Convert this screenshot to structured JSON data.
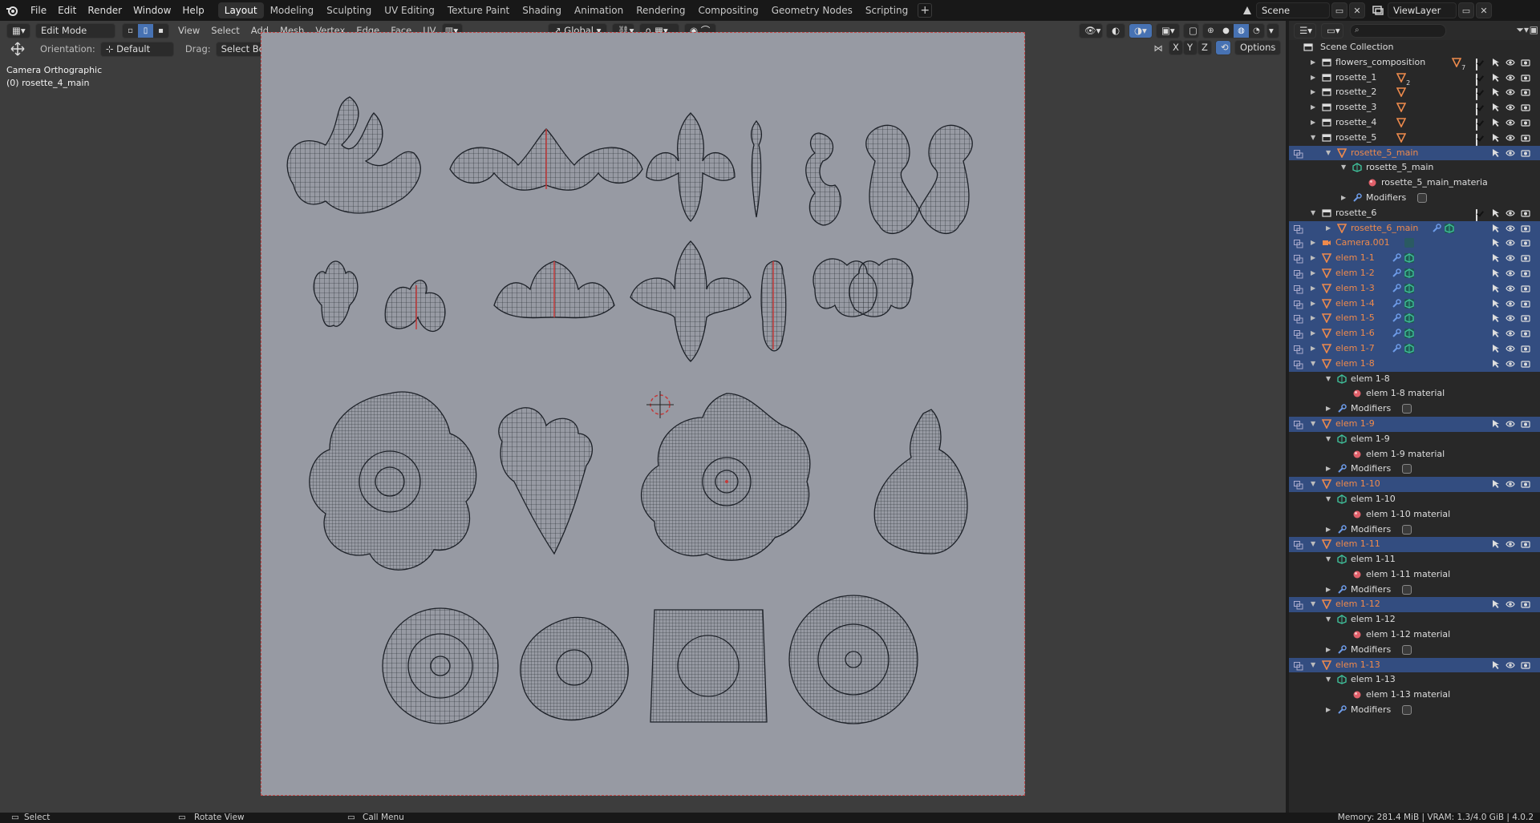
{
  "topbar": {
    "menus": [
      "File",
      "Edit",
      "Render",
      "Window",
      "Help"
    ],
    "workspaces": [
      "Layout",
      "Modeling",
      "Sculpting",
      "UV Editing",
      "Texture Paint",
      "Shading",
      "Animation",
      "Rendering",
      "Compositing",
      "Geometry Nodes",
      "Scripting"
    ],
    "active_workspace": "Layout",
    "add_workspace": "+",
    "scene": "Scene",
    "view_layer": "ViewLayer"
  },
  "viewport_header": {
    "mode": "Edit Mode",
    "menus": [
      "View",
      "Select",
      "Add",
      "Mesh",
      "Vertex",
      "Edge",
      "Face",
      "UV"
    ],
    "transform_orientation": "Global",
    "orientation_label": "Orientation:",
    "orientation_value": "Default",
    "drag_label": "Drag:",
    "drag_value": "Select Box",
    "axes": [
      "X",
      "Y",
      "Z"
    ],
    "options": "Options"
  },
  "viewport_info": {
    "view_name": "Camera Orthographic",
    "active_object": "(0) rosette_4_main"
  },
  "outliner": {
    "root": "Scene Collection",
    "rows": [
      {
        "label": "flowers_composition",
        "depth": 1,
        "arrow": "right",
        "type": "collection",
        "badge": "7",
        "checkbox": true,
        "selectable": true
      },
      {
        "label": "rosette_1",
        "depth": 1,
        "arrow": "right",
        "type": "collection",
        "badge": "2",
        "checkbox": true,
        "selectable": true
      },
      {
        "label": "rosette_2",
        "depth": 1,
        "arrow": "right",
        "type": "collection",
        "badge": "",
        "checkbox": true,
        "selectable": true
      },
      {
        "label": "rosette_3",
        "depth": 1,
        "arrow": "right",
        "type": "collection",
        "badge": "",
        "checkbox": true,
        "selectable": true
      },
      {
        "label": "rosette_4",
        "depth": 1,
        "arrow": "right",
        "type": "collection",
        "badge": "",
        "checkbox": true,
        "selectable": true
      },
      {
        "label": "rosette_5",
        "depth": 1,
        "arrow": "down",
        "type": "collection",
        "badge": "",
        "checkbox": true,
        "selectable": true
      },
      {
        "label": "rosette_5_main",
        "depth": 2,
        "arrow": "down",
        "type": "object",
        "orange": true,
        "selected": true,
        "selectable": true
      },
      {
        "label": "rosette_5_main",
        "depth": 3,
        "arrow": "down",
        "type": "mesh"
      },
      {
        "label": "rosette_5_main_materia",
        "depth": 4,
        "arrow": "",
        "type": "material"
      },
      {
        "label": "Modifiers",
        "depth": 3,
        "arrow": "right",
        "type": "modifier",
        "modbadge": true
      },
      {
        "label": "rosette_6",
        "depth": 1,
        "arrow": "down",
        "type": "collection",
        "checkbox": true,
        "selectable": true
      },
      {
        "label": "rosette_6_main",
        "depth": 2,
        "arrow": "right",
        "type": "object",
        "orange": true,
        "selected": true,
        "wrench": true,
        "selectable": true
      },
      {
        "label": "Camera.001",
        "depth": 1,
        "arrow": "right",
        "type": "camera",
        "orange": true,
        "selected": true,
        "selectable": true
      },
      {
        "label": "elem 1-1",
        "depth": 1,
        "arrow": "right",
        "type": "object",
        "orange": true,
        "selected": true,
        "wrench": true,
        "selectable": true
      },
      {
        "label": "elem 1-2",
        "depth": 1,
        "arrow": "right",
        "type": "object",
        "orange": true,
        "selected": true,
        "wrench": true,
        "selectable": true
      },
      {
        "label": "elem 1-3",
        "depth": 1,
        "arrow": "right",
        "type": "object",
        "orange": true,
        "selected": true,
        "wrench": true,
        "selectable": true
      },
      {
        "label": "elem 1-4",
        "depth": 1,
        "arrow": "right",
        "type": "object",
        "orange": true,
        "selected": true,
        "wrench": true,
        "selectable": true
      },
      {
        "label": "elem 1-5",
        "depth": 1,
        "arrow": "right",
        "type": "object",
        "orange": true,
        "selected": true,
        "wrench": true,
        "selectable": true
      },
      {
        "label": "elem 1-6",
        "depth": 1,
        "arrow": "right",
        "type": "object",
        "orange": true,
        "selected": true,
        "wrench": true,
        "selectable": true
      },
      {
        "label": "elem 1-7",
        "depth": 1,
        "arrow": "right",
        "type": "object",
        "orange": true,
        "selected": true,
        "wrench": true,
        "selectable": true
      },
      {
        "label": "elem 1-8",
        "depth": 1,
        "arrow": "down",
        "type": "object",
        "orange": true,
        "selected": true,
        "selectable": true
      },
      {
        "label": "elem 1-8",
        "depth": 2,
        "arrow": "down",
        "type": "mesh"
      },
      {
        "label": "elem 1-8 material",
        "depth": 3,
        "arrow": "",
        "type": "material"
      },
      {
        "label": "Modifiers",
        "depth": 2,
        "arrow": "right",
        "type": "modifier",
        "modbadge": true
      },
      {
        "label": "elem 1-9",
        "depth": 1,
        "arrow": "down",
        "type": "object",
        "orange": true,
        "selected": true,
        "selectable": true
      },
      {
        "label": "elem 1-9",
        "depth": 2,
        "arrow": "down",
        "type": "mesh"
      },
      {
        "label": "elem 1-9 material",
        "depth": 3,
        "arrow": "",
        "type": "material"
      },
      {
        "label": "Modifiers",
        "depth": 2,
        "arrow": "right",
        "type": "modifier",
        "modbadge": true
      },
      {
        "label": "elem 1-10",
        "depth": 1,
        "arrow": "down",
        "type": "object",
        "orange": true,
        "selected": true,
        "selectable": true
      },
      {
        "label": "elem 1-10",
        "depth": 2,
        "arrow": "down",
        "type": "mesh"
      },
      {
        "label": "elem 1-10 material",
        "depth": 3,
        "arrow": "",
        "type": "material"
      },
      {
        "label": "Modifiers",
        "depth": 2,
        "arrow": "right",
        "type": "modifier",
        "modbadge": true
      },
      {
        "label": "elem 1-11",
        "depth": 1,
        "arrow": "down",
        "type": "object",
        "orange": true,
        "selected": true,
        "selectable": true
      },
      {
        "label": "elem 1-11",
        "depth": 2,
        "arrow": "down",
        "type": "mesh"
      },
      {
        "label": "elem 1-11 material",
        "depth": 3,
        "arrow": "",
        "type": "material"
      },
      {
        "label": "Modifiers",
        "depth": 2,
        "arrow": "right",
        "type": "modifier",
        "modbadge": true
      },
      {
        "label": "elem 1-12",
        "depth": 1,
        "arrow": "down",
        "type": "object",
        "orange": true,
        "selected": true,
        "selectable": true
      },
      {
        "label": "elem 1-12",
        "depth": 2,
        "arrow": "down",
        "type": "mesh"
      },
      {
        "label": "elem 1-12 material",
        "depth": 3,
        "arrow": "",
        "type": "material"
      },
      {
        "label": "Modifiers",
        "depth": 2,
        "arrow": "right",
        "type": "modifier",
        "modbadge": true
      },
      {
        "label": "elem 1-13",
        "depth": 1,
        "arrow": "down",
        "type": "object",
        "orange": true,
        "selected": true,
        "selectable": true
      },
      {
        "label": "elem 1-13",
        "depth": 2,
        "arrow": "down",
        "type": "mesh"
      },
      {
        "label": "elem 1-13 material",
        "depth": 3,
        "arrow": "",
        "type": "material"
      },
      {
        "label": "Modifiers",
        "depth": 2,
        "arrow": "right",
        "type": "modifier",
        "modbadge": true
      }
    ]
  },
  "statusbar": {
    "left_action": "Select",
    "middle_action": "Rotate View",
    "right_action": "Call Menu",
    "stats": "Memory: 281.4 MiB | VRAM: 1.3/4.0 GiB | 4.0.2"
  },
  "colors": {
    "accent": "#4772b3",
    "selected_row": "#334d80",
    "object_orange": "#ee8a4c",
    "mesh_green": "#3fbf9a",
    "material_red": "#e0606a",
    "modifier_blue": "#6d9be8",
    "camera_frame": "#979aa3",
    "wire": "#1d2128"
  },
  "icons": {
    "logo": "blender-logo-icon",
    "visibility": "eye-icon",
    "render": "camera-render-icon",
    "select": "cursor-arrow-icon",
    "collection": "collection-box-icon",
    "object": "mesh-object-triangle-icon",
    "mesh": "mesh-data-icon",
    "material": "material-sphere-icon",
    "modifier": "wrench-icon",
    "camera": "camera-object-icon"
  }
}
